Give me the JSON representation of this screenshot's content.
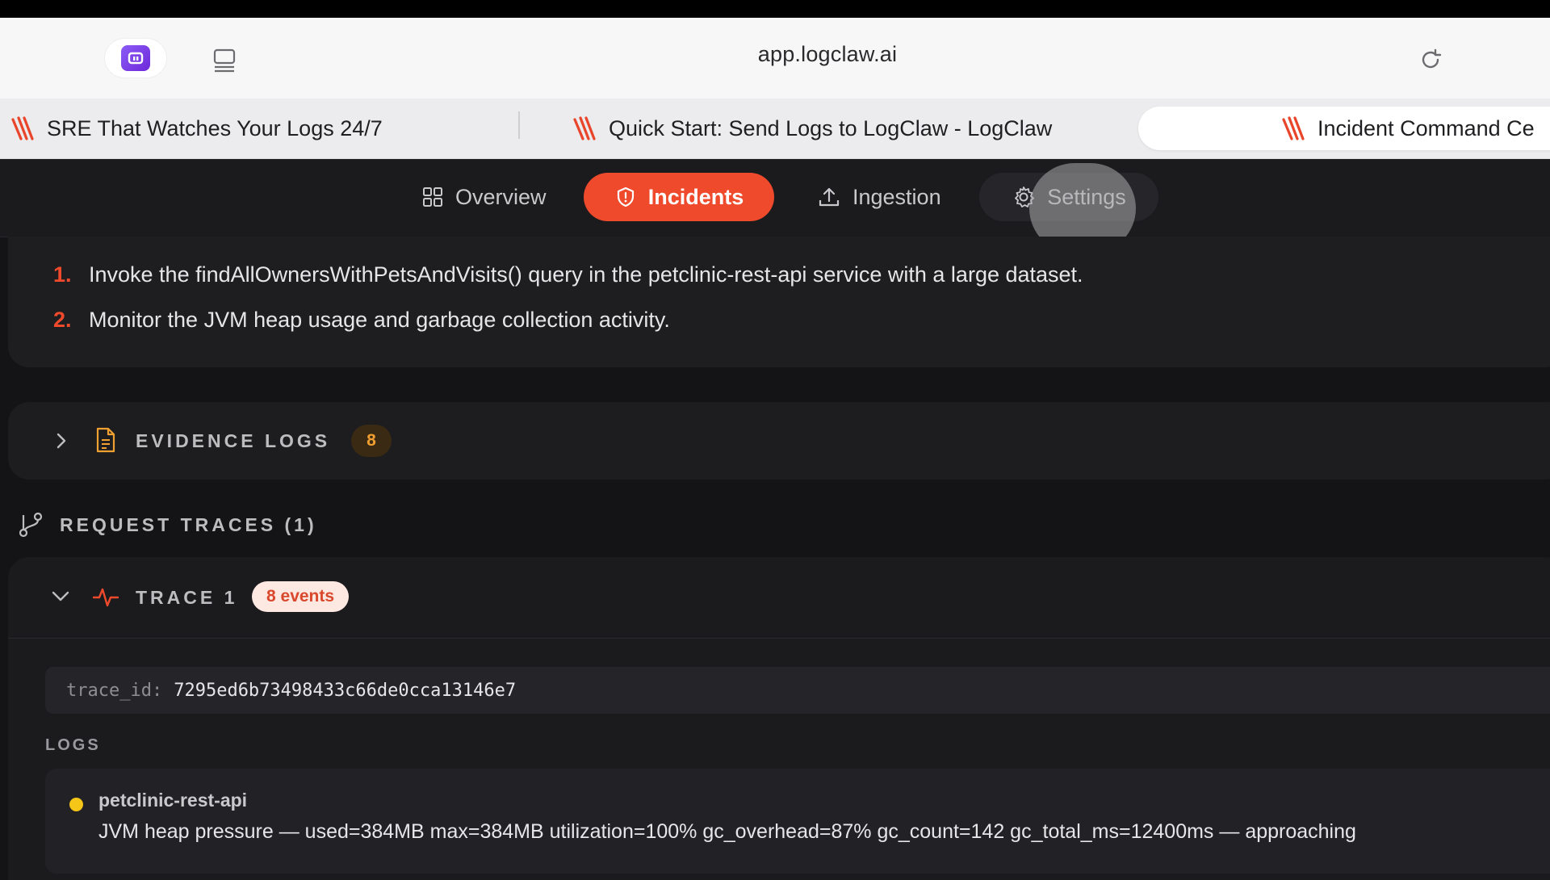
{
  "browser": {
    "url": "app.logclaw.ai",
    "tabs": [
      {
        "title": "SRE That Watches Your Logs 24/7",
        "active": false
      },
      {
        "title": "Quick Start: Send Logs to LogClaw - LogClaw",
        "active": false
      },
      {
        "title": "Incident Command Ce",
        "active": true
      }
    ]
  },
  "nav": {
    "items": [
      {
        "label": "Overview",
        "icon": "grid-icon",
        "active": false
      },
      {
        "label": "Incidents",
        "icon": "shield-icon",
        "active": true
      },
      {
        "label": "Ingestion",
        "icon": "upload-icon",
        "active": false
      },
      {
        "label": "Settings",
        "icon": "gear-icon",
        "active": false
      }
    ]
  },
  "steps": [
    {
      "num": "1.",
      "text": "Invoke the findAllOwnersWithPetsAndVisits() query in the petclinic-rest-api service with a large dataset."
    },
    {
      "num": "2.",
      "text": "Monitor the JVM heap usage and garbage collection activity."
    }
  ],
  "evidence": {
    "title": "EVIDENCE LOGS",
    "count": "8"
  },
  "traces": {
    "title": "REQUEST TRACES (1)",
    "items": [
      {
        "name": "TRACE 1",
        "events": "8 events",
        "trace_id_key": "trace_id:",
        "trace_id": "7295ed6b73498433c66de0cca13146e7",
        "logs_label": "LOGS",
        "logs": [
          {
            "service": "petclinic-rest-api",
            "level_color": "#f5c518",
            "message": "JVM heap pressure — used=384MB max=384MB utilization=100% gc_overhead=87% gc_count=142 gc_total_ms=12400ms — approaching"
          }
        ]
      }
    ]
  },
  "colors": {
    "accent": "#ef4a2c",
    "background": "#141416",
    "warning": "#f5c518"
  }
}
